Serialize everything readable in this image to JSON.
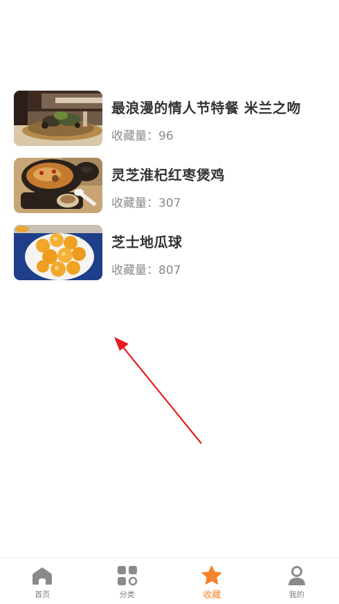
{
  "favorites": {
    "count_label": "收藏量：",
    "items": [
      {
        "title": "最浪漫的情人节特餐 米兰之吻",
        "count": "96",
        "image": "dish-plate-image"
      },
      {
        "title": "灵芝淮杞红枣煲鸡",
        "count": "307",
        "image": "soup-pot-image"
      },
      {
        "title": "芝士地瓜球",
        "count": "807",
        "image": "cheese-sweet-potato-balls-image"
      }
    ]
  },
  "tabbar": {
    "tabs": [
      {
        "label": "首页",
        "icon": "home-icon",
        "active": false
      },
      {
        "label": "分类",
        "icon": "category-icon",
        "active": false
      },
      {
        "label": "收藏",
        "icon": "star-icon",
        "active": true
      },
      {
        "label": "我的",
        "icon": "user-icon",
        "active": false
      }
    ]
  },
  "colors": {
    "accent": "#f5832a",
    "title_text": "#333333",
    "meta_text": "#8a8a8a",
    "inactive_tab": "#7d7d7d",
    "annotation_arrow": "#e8191f"
  }
}
